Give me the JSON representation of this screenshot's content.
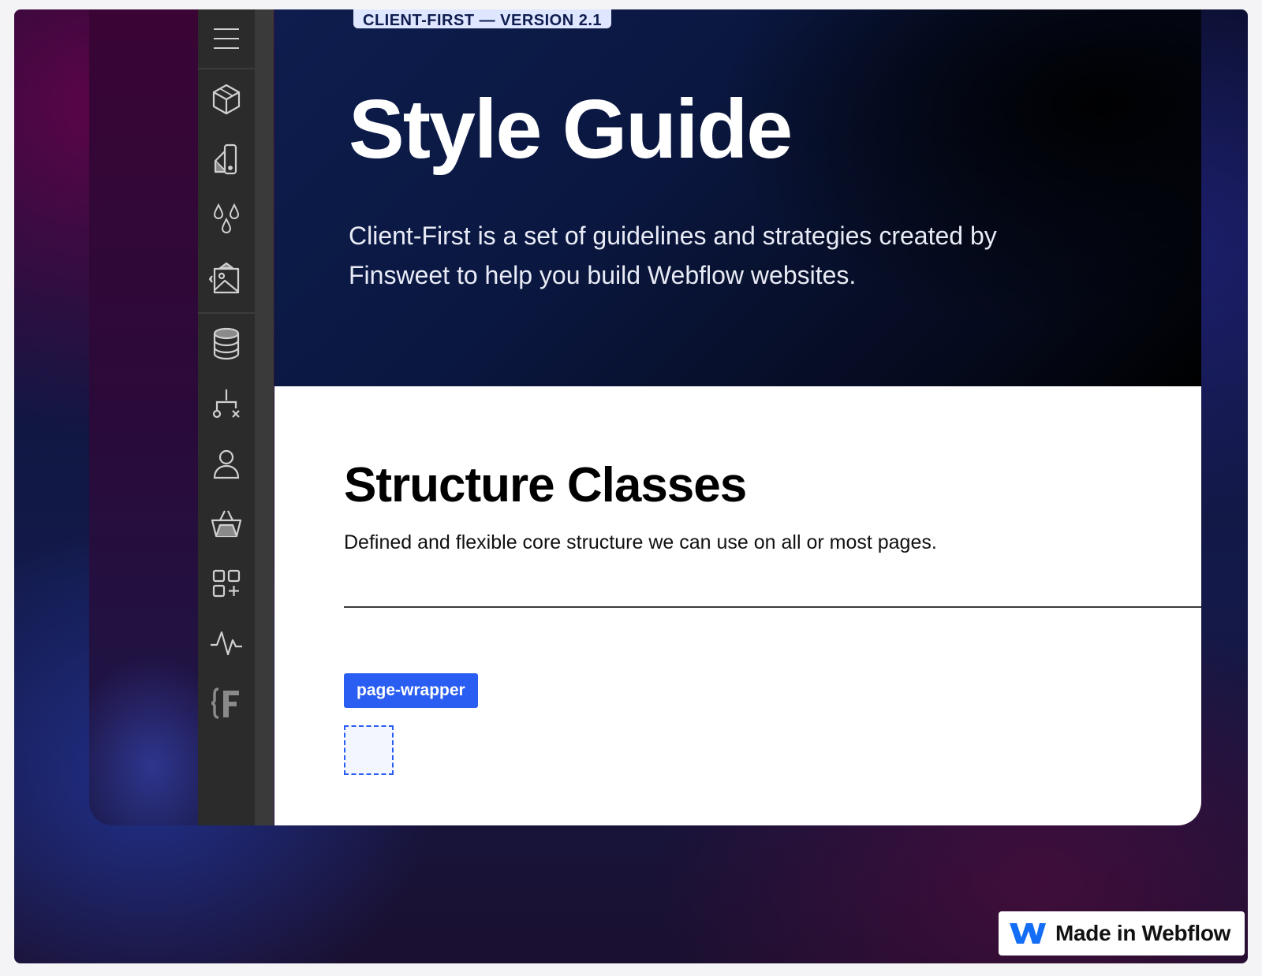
{
  "hero": {
    "version": "CLIENT-FIRST — VERSION 2.1",
    "title": "Style Guide",
    "description": "Client-First is a set of guidelines and strategies created by Finsweet to help you build Webflow websites."
  },
  "section": {
    "title": "Structure Classes",
    "description": "Defined and flexible core structure we can use on all or most pages."
  },
  "example": {
    "class_tag": "page-wrapper"
  },
  "sidebar": {
    "items": [
      {
        "icon": "menu-icon"
      },
      {
        "icon": "cube-icon"
      },
      {
        "icon": "swatch-icon"
      },
      {
        "icon": "drops-icon"
      },
      {
        "icon": "image-icon"
      },
      {
        "icon": "database-icon"
      },
      {
        "icon": "logic-icon"
      },
      {
        "icon": "user-icon"
      },
      {
        "icon": "basket-icon"
      },
      {
        "icon": "apps-icon"
      },
      {
        "icon": "activity-icon"
      },
      {
        "icon": "finsweet-icon"
      }
    ]
  },
  "badge": {
    "label": "Made in Webflow",
    "accent": "#146ef5"
  },
  "colors": {
    "class_tag": "#2a5ef2",
    "sidebar_bg": "#2b2b2b",
    "icon_stroke": "#d0d0d0"
  }
}
